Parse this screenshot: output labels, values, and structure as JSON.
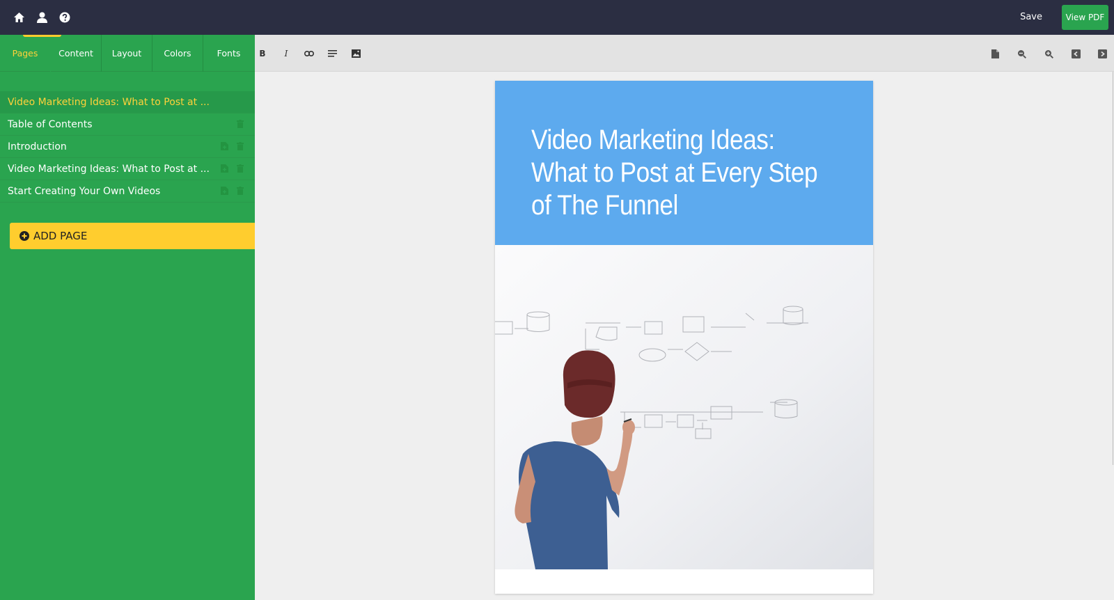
{
  "topbar": {
    "icons": [
      "home-icon",
      "user-icon",
      "help-icon"
    ],
    "save_label": "Save",
    "view_pdf_label": "View PDF"
  },
  "sidebar": {
    "tabs": [
      {
        "label": "Pages",
        "active": true
      },
      {
        "label": "Content",
        "active": false
      },
      {
        "label": "Layout",
        "active": false
      },
      {
        "label": "Colors",
        "active": false
      },
      {
        "label": "Fonts",
        "active": false
      }
    ],
    "pages": [
      {
        "label": "Video Marketing Ideas: What to Post at ...",
        "selected": true,
        "actions": []
      },
      {
        "label": "Table of Contents",
        "selected": false,
        "actions": [
          "trash-icon"
        ]
      },
      {
        "label": "Introduction",
        "selected": false,
        "actions": [
          "duplicate-icon",
          "trash-icon"
        ]
      },
      {
        "label": "Video Marketing Ideas: What to Post at ...",
        "selected": false,
        "actions": [
          "duplicate-icon",
          "trash-icon"
        ]
      },
      {
        "label": "Start Creating Your Own Videos",
        "selected": false,
        "actions": [
          "duplicate-icon",
          "trash-icon"
        ]
      }
    ],
    "add_page_label": "ADD PAGE"
  },
  "toolbar": {
    "left_tools": [
      "B",
      "I",
      "link-icon",
      "align-icon",
      "image-icon"
    ],
    "right_tools": [
      "page-icon",
      "zoom-out-icon",
      "zoom-in-icon",
      "prev-page-icon",
      "next-page-icon"
    ]
  },
  "document": {
    "cover_title_lines": [
      "Video Marketing Ideas:",
      "What to Post at Every Step",
      "of The Funnel"
    ]
  },
  "colors": {
    "topbar": "#2b2e42",
    "sidebar": "#2aa44f",
    "accent_yellow": "#ffcd2e",
    "cover_band": "#5daaee",
    "view_pdf": "#2aa44f"
  }
}
